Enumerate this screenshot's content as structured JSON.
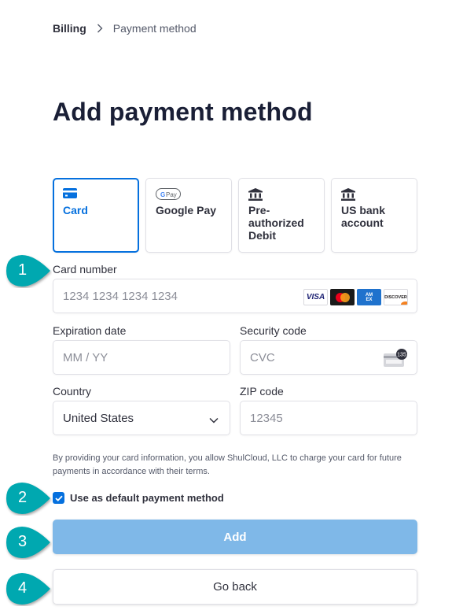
{
  "breadcrumb": {
    "root": "Billing",
    "separator_icon": "chevron-right-icon",
    "current": "Payment method"
  },
  "page_title": "Add payment method",
  "methods": [
    {
      "label": "Card",
      "icon": "credit-card-icon",
      "selected": true
    },
    {
      "label": "Google Pay",
      "icon": "google-pay-icon",
      "selected": false
    },
    {
      "label": "Pre-\nauthorized\nDebit",
      "icon": "bank-icon",
      "selected": false
    },
    {
      "label": "US bank\naccount",
      "icon": "bank-icon",
      "selected": false
    }
  ],
  "google_pay_badge": "G Pay",
  "card_number": {
    "label": "Card number",
    "placeholder": "1234 1234 1234 1234",
    "brands": [
      "VISA",
      "Mastercard",
      "AMEX",
      "DISCOVER"
    ]
  },
  "expiration": {
    "label": "Expiration date",
    "placeholder": "MM / YY"
  },
  "security_code": {
    "label": "Security code",
    "placeholder": "CVC",
    "icon_badge": "135"
  },
  "country": {
    "label": "Country",
    "value": "United States"
  },
  "zip": {
    "label": "ZIP code",
    "placeholder": "12345"
  },
  "disclaimer": "By providing your card information, you allow ShulCloud, LLC to charge your card for future payments in accordance with their terms.",
  "default_checkbox": {
    "label": "Use as default payment method",
    "checked": true
  },
  "buttons": {
    "add": "Add",
    "back": "Go back"
  },
  "callouts": [
    "1",
    "2",
    "3",
    "4"
  ],
  "colors": {
    "accent": "#0570de",
    "add_button": "#7fb8e8",
    "callout": "#00a8b0",
    "title": "#1a1f36"
  }
}
